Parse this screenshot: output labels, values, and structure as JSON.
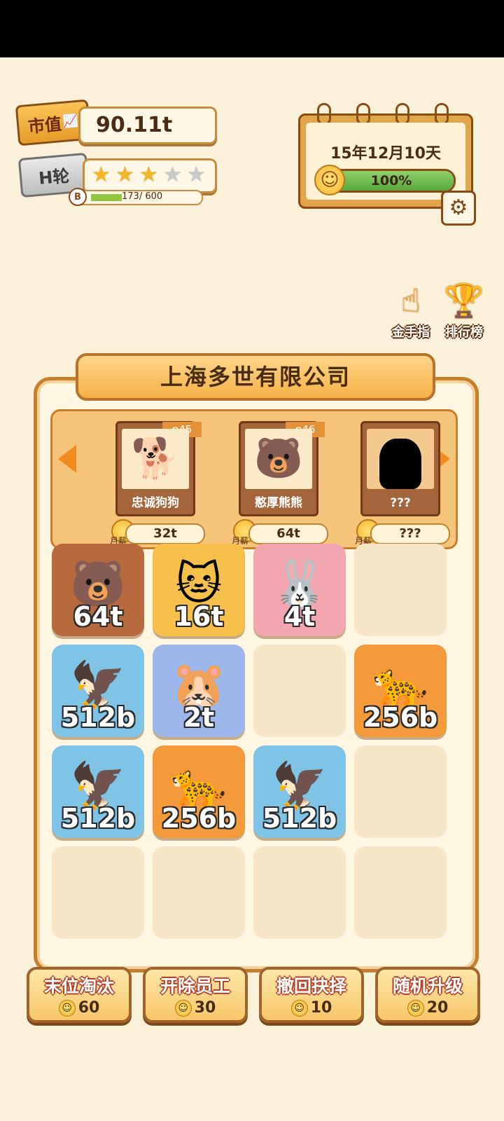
{
  "status": {
    "market_label": "市值",
    "market_value": "90.11t",
    "round_label": "H轮",
    "stars_total": 5,
    "stars_filled": 3,
    "exp_badge": "B",
    "exp_text": "173/ 600",
    "exp_progress": 0.29
  },
  "calendar": {
    "date": "15年12月10天",
    "mood_text": "100%",
    "mood_progress": 1.0
  },
  "side_buttons": [
    {
      "label": "金手指",
      "icon": "hand-pointer-icon"
    },
    {
      "label": "排行榜",
      "icon": "trophy-icon"
    }
  ],
  "company": {
    "name": "上海多世有限公司"
  },
  "candidates": [
    {
      "name": "忠诚狗狗",
      "tag": "p45",
      "salary_label": "月薪",
      "salary": "32t",
      "icon": "shiba-dog-icon"
    },
    {
      "name": "憨厚熊熊",
      "tag": "p46",
      "salary_label": "月薪",
      "salary": "64t",
      "icon": "bear-icon"
    },
    {
      "name": "???",
      "tag": "",
      "salary_label": "月薪",
      "salary": "???",
      "icon": "silhouette-icon"
    }
  ],
  "grid": [
    [
      {
        "value": "64t",
        "animal": "bear",
        "bg": "#b86a3f"
      },
      {
        "value": "16t",
        "animal": "cat",
        "bg": "#f6c04a"
      },
      {
        "value": "4t",
        "animal": "rabbit",
        "bg": "#f2a7b0"
      },
      {
        "value": "",
        "animal": "",
        "bg": ""
      }
    ],
    [
      {
        "value": "512b",
        "animal": "eagle",
        "bg": "#7fc3e6"
      },
      {
        "value": "2t",
        "animal": "hamster",
        "bg": "#9cb7ea"
      },
      {
        "value": "",
        "animal": "",
        "bg": ""
      },
      {
        "value": "256b",
        "animal": "leopard",
        "bg": "#f49a3a"
      }
    ],
    [
      {
        "value": "512b",
        "animal": "eagle",
        "bg": "#7fc3e6"
      },
      {
        "value": "256b",
        "animal": "leopard",
        "bg": "#f49a3a"
      },
      {
        "value": "512b",
        "animal": "eagle",
        "bg": "#7fc3e6"
      },
      {
        "value": "",
        "animal": "",
        "bg": ""
      }
    ],
    [
      {
        "value": "",
        "animal": "",
        "bg": ""
      },
      {
        "value": "",
        "animal": "",
        "bg": ""
      },
      {
        "value": "",
        "animal": "",
        "bg": ""
      },
      {
        "value": "",
        "animal": "",
        "bg": ""
      }
    ]
  ],
  "actions": [
    {
      "title": "末位淘汰",
      "cost": "60"
    },
    {
      "title": "开除员工",
      "cost": "30"
    },
    {
      "title": "撤回抉择",
      "cost": "10"
    },
    {
      "title": "随机升级",
      "cost": "20"
    }
  ]
}
